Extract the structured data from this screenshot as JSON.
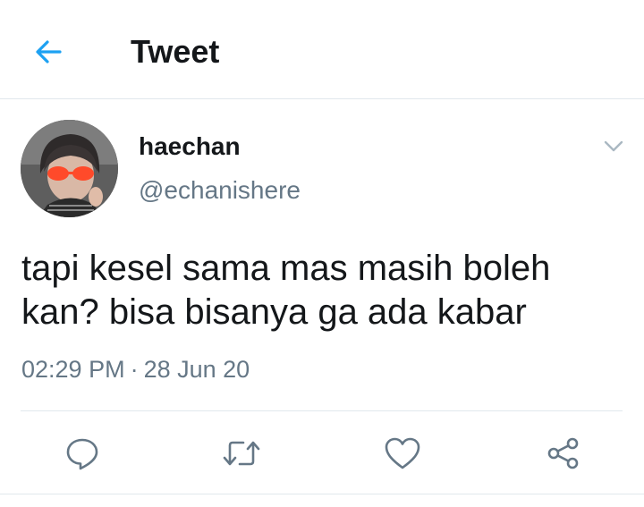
{
  "header": {
    "back_icon": "arrow-left-icon",
    "title": "Tweet"
  },
  "author": {
    "name": "haechan",
    "handle": "@echanishere",
    "menu_icon": "chevron-down-icon"
  },
  "tweet": {
    "text": "tapi kesel sama mas masih boleh\nkan? bisa bisanya ga ada kabar",
    "time": "02:29 PM",
    "separator": "·",
    "date": "28 Jun 20"
  },
  "actions": [
    {
      "icon": "reply-icon"
    },
    {
      "icon": "retweet-icon"
    },
    {
      "icon": "like-icon"
    },
    {
      "icon": "share-icon"
    }
  ],
  "colors": {
    "accent": "#1da1f2",
    "text_primary": "#14171a",
    "text_secondary": "#657786",
    "icon_gray": "#657786",
    "divider": "#e1e8ed"
  }
}
